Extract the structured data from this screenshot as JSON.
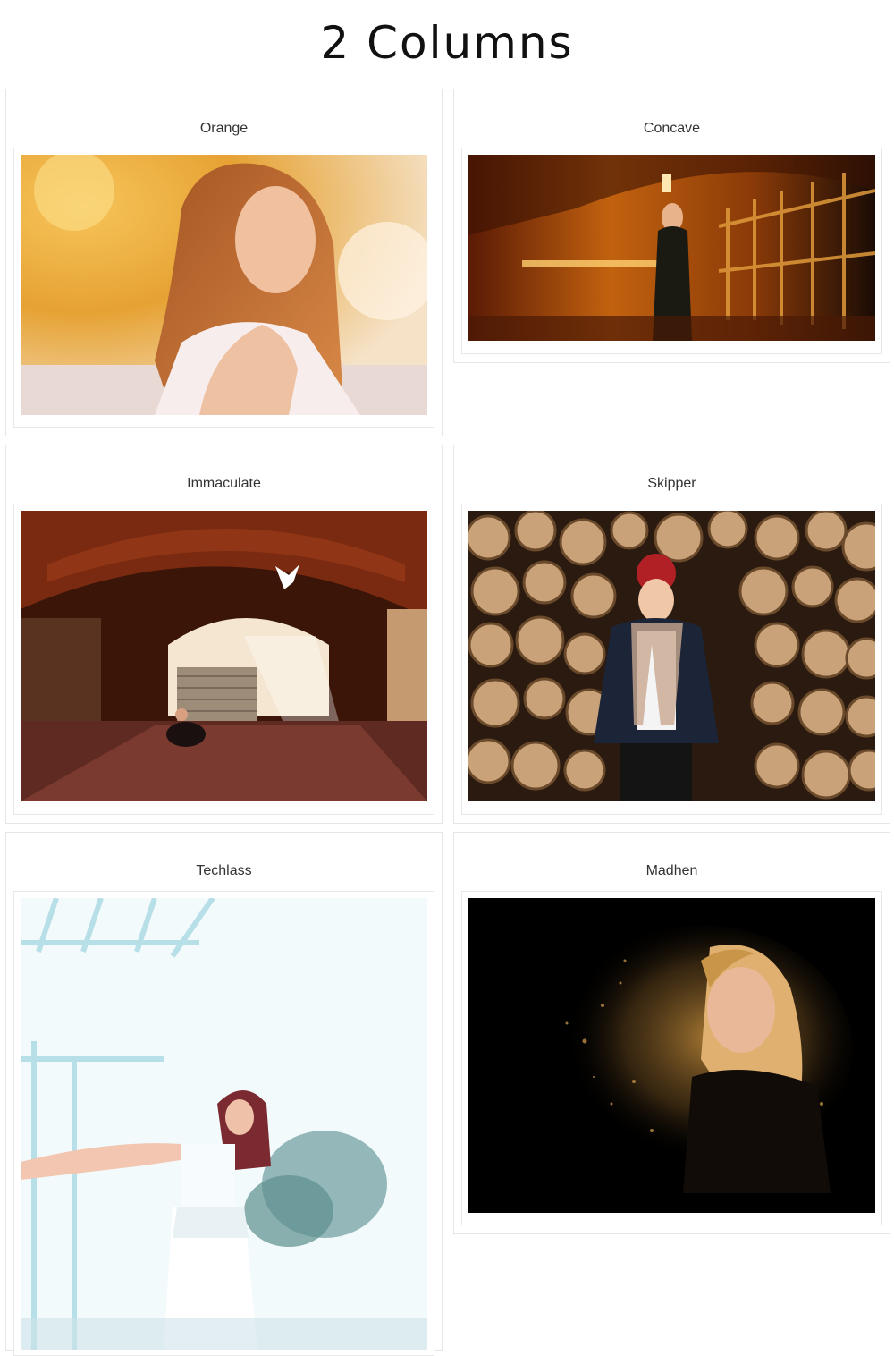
{
  "page": {
    "title": "2 Columns"
  },
  "gallery": [
    {
      "caption": "Orange",
      "image": "portrait-woman-warm-light"
    },
    {
      "caption": "Concave",
      "image": "woman-in-lit-corridor"
    },
    {
      "caption": "Immaculate",
      "image": "woman-under-brick-arch-with-dove"
    },
    {
      "caption": "Skipper",
      "image": "woman-in-red-hat-before-log-pile"
    },
    {
      "caption": "Techlass",
      "image": "woman-in-white-dress-bright-outdoors"
    },
    {
      "caption": "Madhen",
      "image": "woman-dissolving-into-golden-particles"
    }
  ]
}
